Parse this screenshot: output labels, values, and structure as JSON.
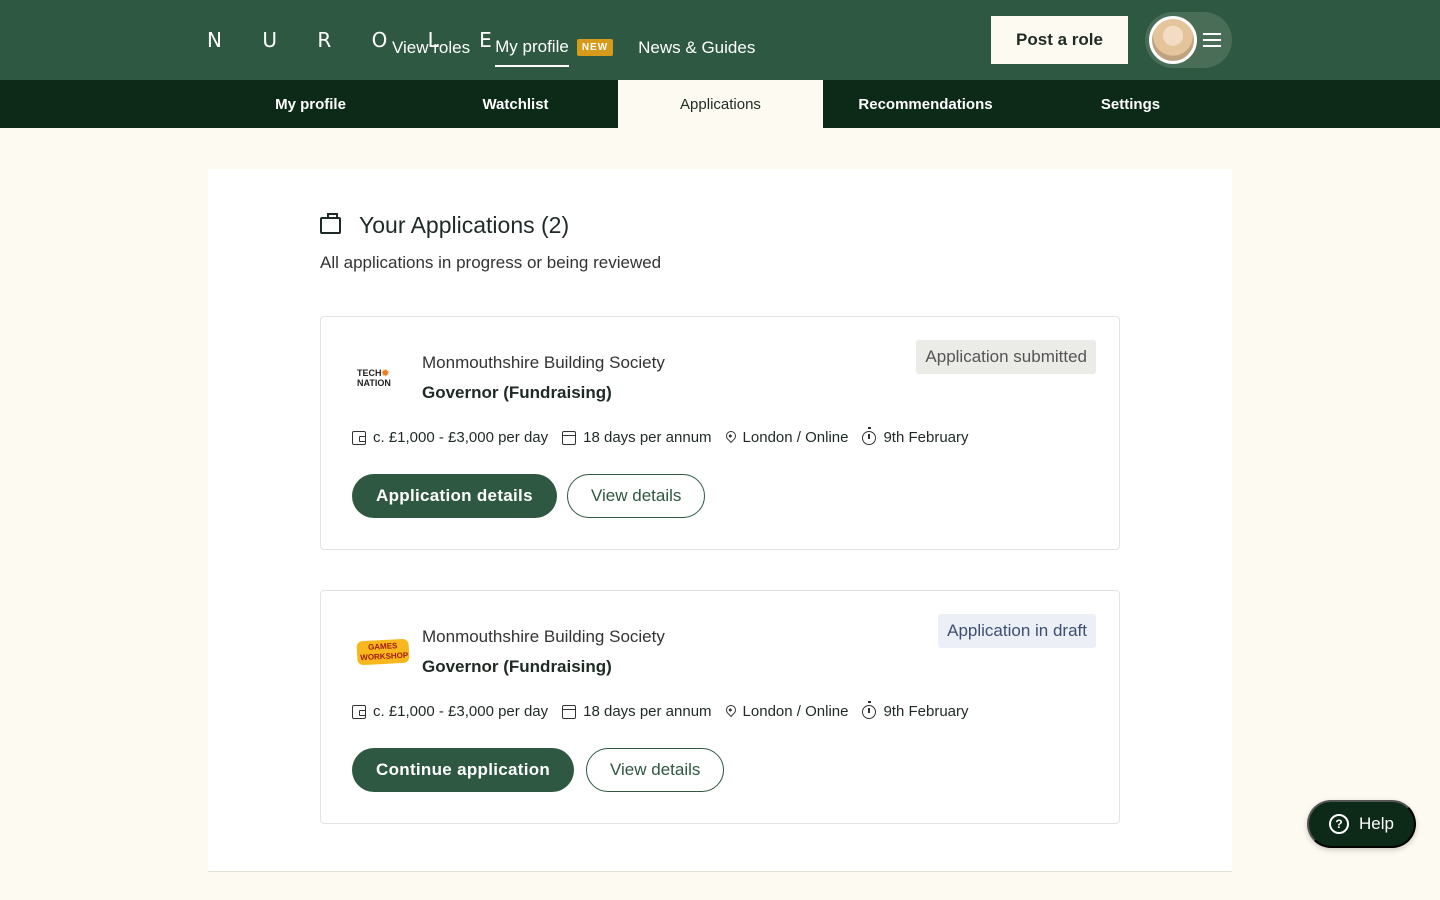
{
  "header": {
    "logo": "N U R O L E",
    "nav": {
      "view_roles": "View roles",
      "my_profile": "My profile",
      "new_badge": "NEW",
      "news_guides": "News & Guides"
    },
    "post_role": "Post a role"
  },
  "subnav": {
    "tabs": [
      "My profile",
      "Watchlist",
      "Applications",
      "Recommendations",
      "Settings"
    ],
    "active": "Applications"
  },
  "main": {
    "title": "Your Applications (2)",
    "subtitle": "All applications in progress or being reviewed"
  },
  "applications": [
    {
      "logo_text_1": "TECH",
      "logo_text_2": "NATION",
      "organisation": "Monmouthshire Building Society",
      "role": "Governor (Fundraising)",
      "status": "Application submitted",
      "salary": "c. £1,000 - £3,000 per day",
      "time_commitment": "18 days per annum",
      "location": "London / Online",
      "deadline": "9th February",
      "primary_action": "Application details",
      "secondary_action": "View details"
    },
    {
      "logo_text_1": "GAMES",
      "logo_text_2": "WORKSHOP",
      "organisation": "Monmouthshire Building Society",
      "role": "Governor (Fundraising)",
      "status": "Application in draft",
      "salary": "c. £1,000 - £3,000 per day",
      "time_commitment": "18 days per annum",
      "location": "London / Online",
      "deadline": "9th February",
      "primary_action": "Continue application",
      "secondary_action": "View details"
    }
  ],
  "help": {
    "label": "Help",
    "icon": "question-circle-icon"
  },
  "colors": {
    "brand_green": "#2e5841",
    "dark_green": "#0d2918",
    "cream": "#fdfbf1",
    "badge_amber": "#d79b1b"
  }
}
